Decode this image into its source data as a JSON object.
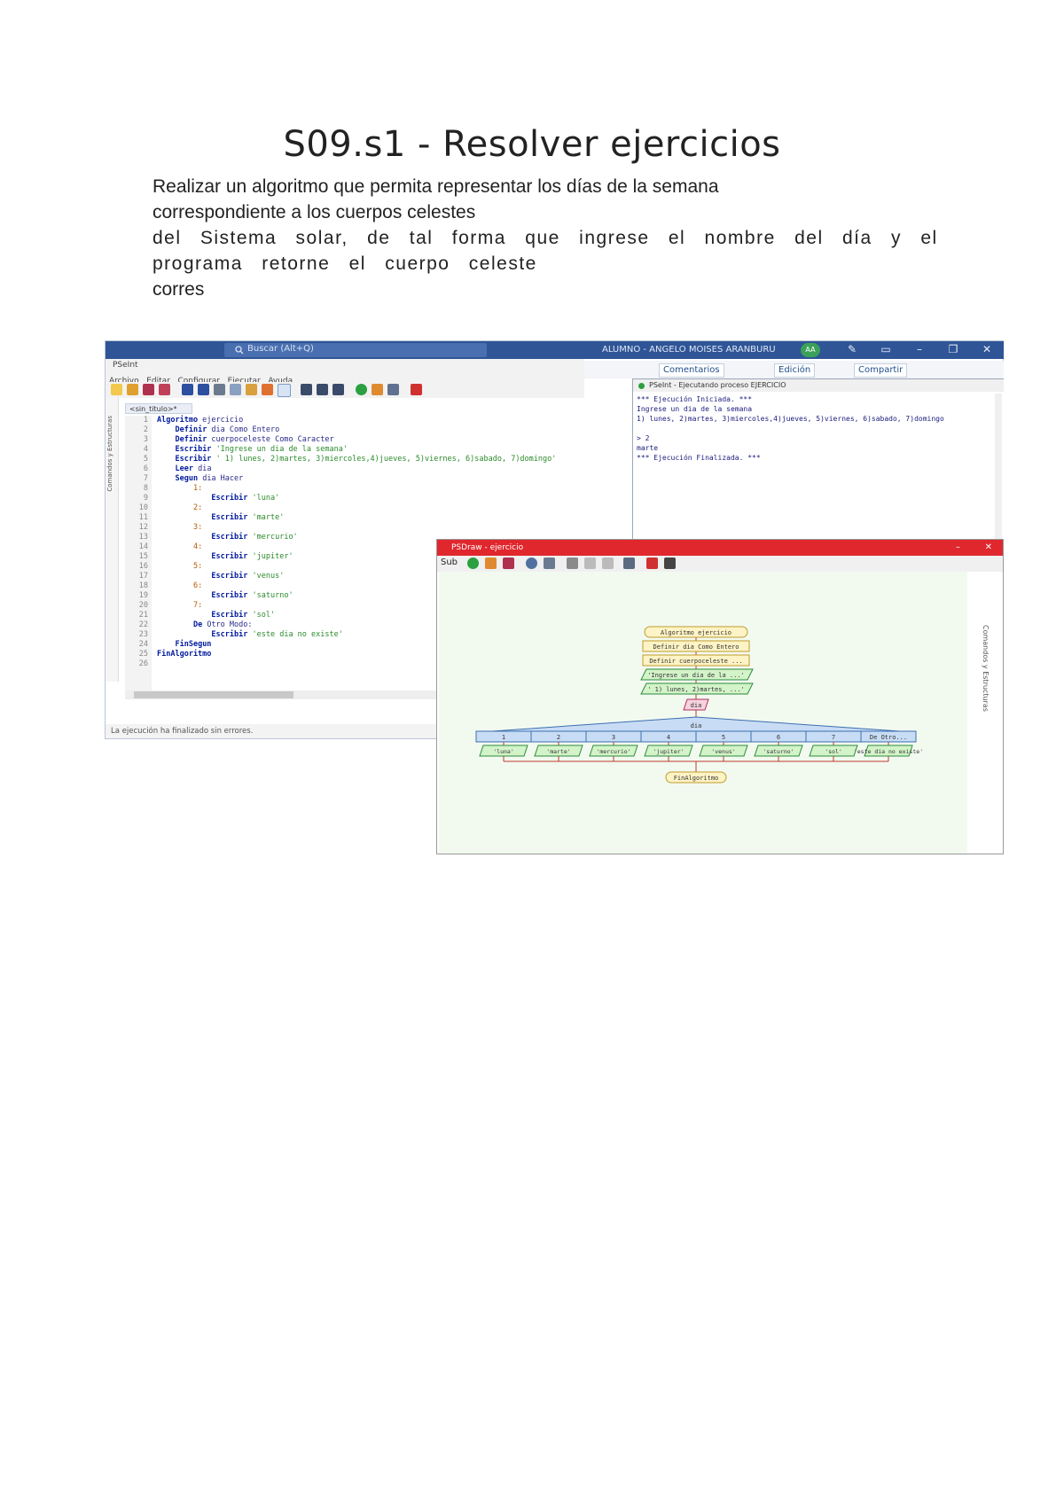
{
  "document": {
    "title": "S09.s1 - Resolver ejercicios",
    "paragraph_lines": [
      "Realizar un algoritmo que permita representar los días de la semana",
      "correspondiente a los cuerpos celestes",
      "del Sistema solar, de tal forma que ingrese el nombre del día y el",
      "programa retorne el cuerpo celeste",
      "corres"
    ]
  },
  "screenshot": {
    "taskbar": {
      "search_placeholder": "Buscar (Alt+Q)",
      "user": "ALUMNO - ANGELO MOISES ARANBURU",
      "avatar": "AA"
    },
    "ide": {
      "app_title": "PSeInt",
      "menu": [
        "Archivo",
        "Editar",
        "Configurar",
        "Ejecutar",
        "Ayuda"
      ],
      "tab": "<sin_titulo>*",
      "side_label": "Comandos y Estructuras",
      "code_lines": [
        "Algoritmo ejercicio",
        "    Definir dia Como Entero",
        "    Definir cuerpoceleste Como Caracter",
        "    Escribir 'Ingrese un dia de la semana'",
        "    Escribir ' 1) lunes, 2)martes, 3)miercoles,4)jueves, 5)viernes, 6)sabado, 7)domingo'",
        "    Leer dia",
        "    Segun dia Hacer",
        "        1:",
        "            Escribir 'luna'",
        "        2:",
        "            Escribir 'marte'",
        "        3:",
        "            Escribir 'mercurio'",
        "        4:",
        "            Escribir 'jupiter'",
        "        5:",
        "            Escribir 'venus'",
        "        6:",
        "            Escribir 'saturno'",
        "        7:",
        "            Escribir 'sol'",
        "        De Otro Modo:",
        "            Escribir 'este dia no existe'",
        "    FinSegun",
        "FinAlgoritmo",
        ""
      ],
      "status": "La ejecución ha finalizado sin errores."
    },
    "ribbon": {
      "comments": "Comentarios",
      "edit": "Edición",
      "share": "Compartir"
    },
    "console": {
      "title": "PSeInt - Ejecutando proceso EJERCICIO",
      "lines": [
        "*** Ejecución Iniciada. ***",
        "Ingrese un dia de la semana",
        " 1) lunes, 2)martes, 3)miercoles,4)jueves, 5)viernes, 6)sabado, 7)domingo",
        "",
        "> 2",
        "marte",
        "*** Ejecución Finalizada. ***"
      ]
    },
    "psdraw": {
      "title": "PSDraw - ejercicio",
      "tool_sub": "Sub",
      "side_label": "Comandos y Estructuras",
      "flow": {
        "start": "Algoritmo ejercicio",
        "define1": "Definir dia Como Entero",
        "define2": "Definir cuerpoceleste ...",
        "write1": "'Ingrese un dia de la ...'",
        "write2": "' 1) lunes, 2)martes, ...'",
        "read": "dia",
        "switch": "dia",
        "cases": [
          "1",
          "2",
          "3",
          "4",
          "5",
          "6",
          "7",
          "De Otro..."
        ],
        "outputs": [
          "'luna'",
          "'marte'",
          "'mercurio'",
          "'jupiter'",
          "'venus'",
          "'saturno'",
          "'sol'",
          "'este dia no existe'"
        ],
        "end": "FinAlgoritmo"
      }
    }
  }
}
